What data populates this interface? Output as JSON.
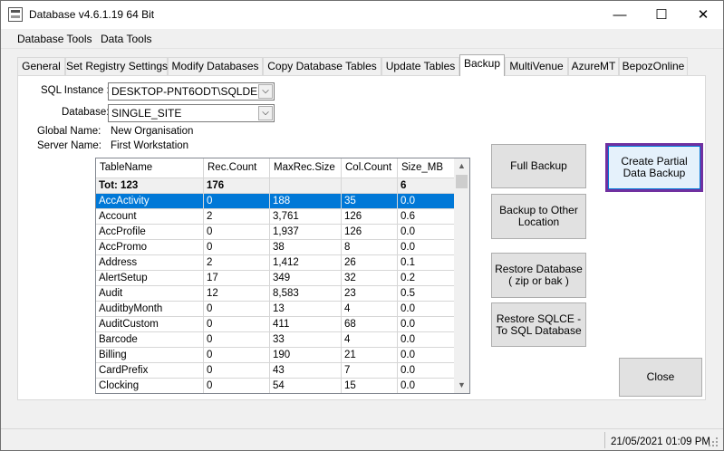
{
  "window": {
    "title": "Database v4.6.1.19 64 Bit",
    "minimize_glyph": "—",
    "maximize_glyph": "☐",
    "close_glyph": "✕"
  },
  "menu": [
    "Database Tools",
    "Data Tools"
  ],
  "tabs": [
    "General",
    "Set Registry Settings",
    "Modify Databases",
    "Copy Database Tables",
    "Update Tables",
    "Backup",
    "MultiVenue",
    "AzureMT",
    "BepozOnline"
  ],
  "active_tab": "Backup",
  "form": {
    "sql_instance_label": "SQL Instance :",
    "sql_instance_value": "DESKTOP-PNT6ODT\\SQLDE",
    "database_label": "Database:",
    "database_value": "SINGLE_SITE",
    "global_name_label": "Global Name:",
    "global_name_value": "New Organisation",
    "server_name_label": "Server Name:",
    "server_name_value": "First Workstation",
    "dropdown_glyph": "⌵"
  },
  "grid": {
    "columns": [
      "TableName",
      "Rec.Count",
      "MaxRec.Size",
      "Col.Count",
      "Size_MB"
    ],
    "total": [
      "Tot: 123",
      "176",
      "",
      "",
      "6"
    ],
    "rows": [
      [
        "AccActivity",
        "0",
        "188",
        "35",
        "0.0"
      ],
      [
        "Account",
        "2",
        "3,761",
        "126",
        "0.6"
      ],
      [
        "AccProfile",
        "0",
        "1,937",
        "126",
        "0.0"
      ],
      [
        "AccPromo",
        "0",
        "38",
        "8",
        "0.0"
      ],
      [
        "Address",
        "2",
        "1,412",
        "26",
        "0.1"
      ],
      [
        "AlertSetup",
        "17",
        "349",
        "32",
        "0.2"
      ],
      [
        "Audit",
        "12",
        "8,583",
        "23",
        "0.5"
      ],
      [
        "AuditbyMonth",
        "0",
        "13",
        "4",
        "0.0"
      ],
      [
        "AuditCustom",
        "0",
        "411",
        "68",
        "0.0"
      ],
      [
        "Barcode",
        "0",
        "33",
        "4",
        "0.0"
      ],
      [
        "Billing",
        "0",
        "190",
        "21",
        "0.0"
      ],
      [
        "CardPrefix",
        "0",
        "43",
        "7",
        "0.0"
      ],
      [
        "Clocking",
        "0",
        "54",
        "15",
        "0.0"
      ]
    ],
    "selected_row": 0,
    "scroll_up_glyph": "▲",
    "scroll_down_glyph": "▼"
  },
  "buttons": {
    "full_backup": "Full Backup",
    "backup_other_1": "Backup to Other",
    "backup_other_2": "Location",
    "restore_db_1": "Restore Database",
    "restore_db_2": "( zip or bak )",
    "restore_sqlce_1": "Restore SQLCE -",
    "restore_sqlce_2": "To SQL Database",
    "partial_1": "Create Partial",
    "partial_2": "Data Backup",
    "close": "Close"
  },
  "status": {
    "datetime": "21/05/2021 01:09 PM"
  },
  "colors": {
    "selection": "#0078d7",
    "highlight_border": "#7030a0"
  }
}
